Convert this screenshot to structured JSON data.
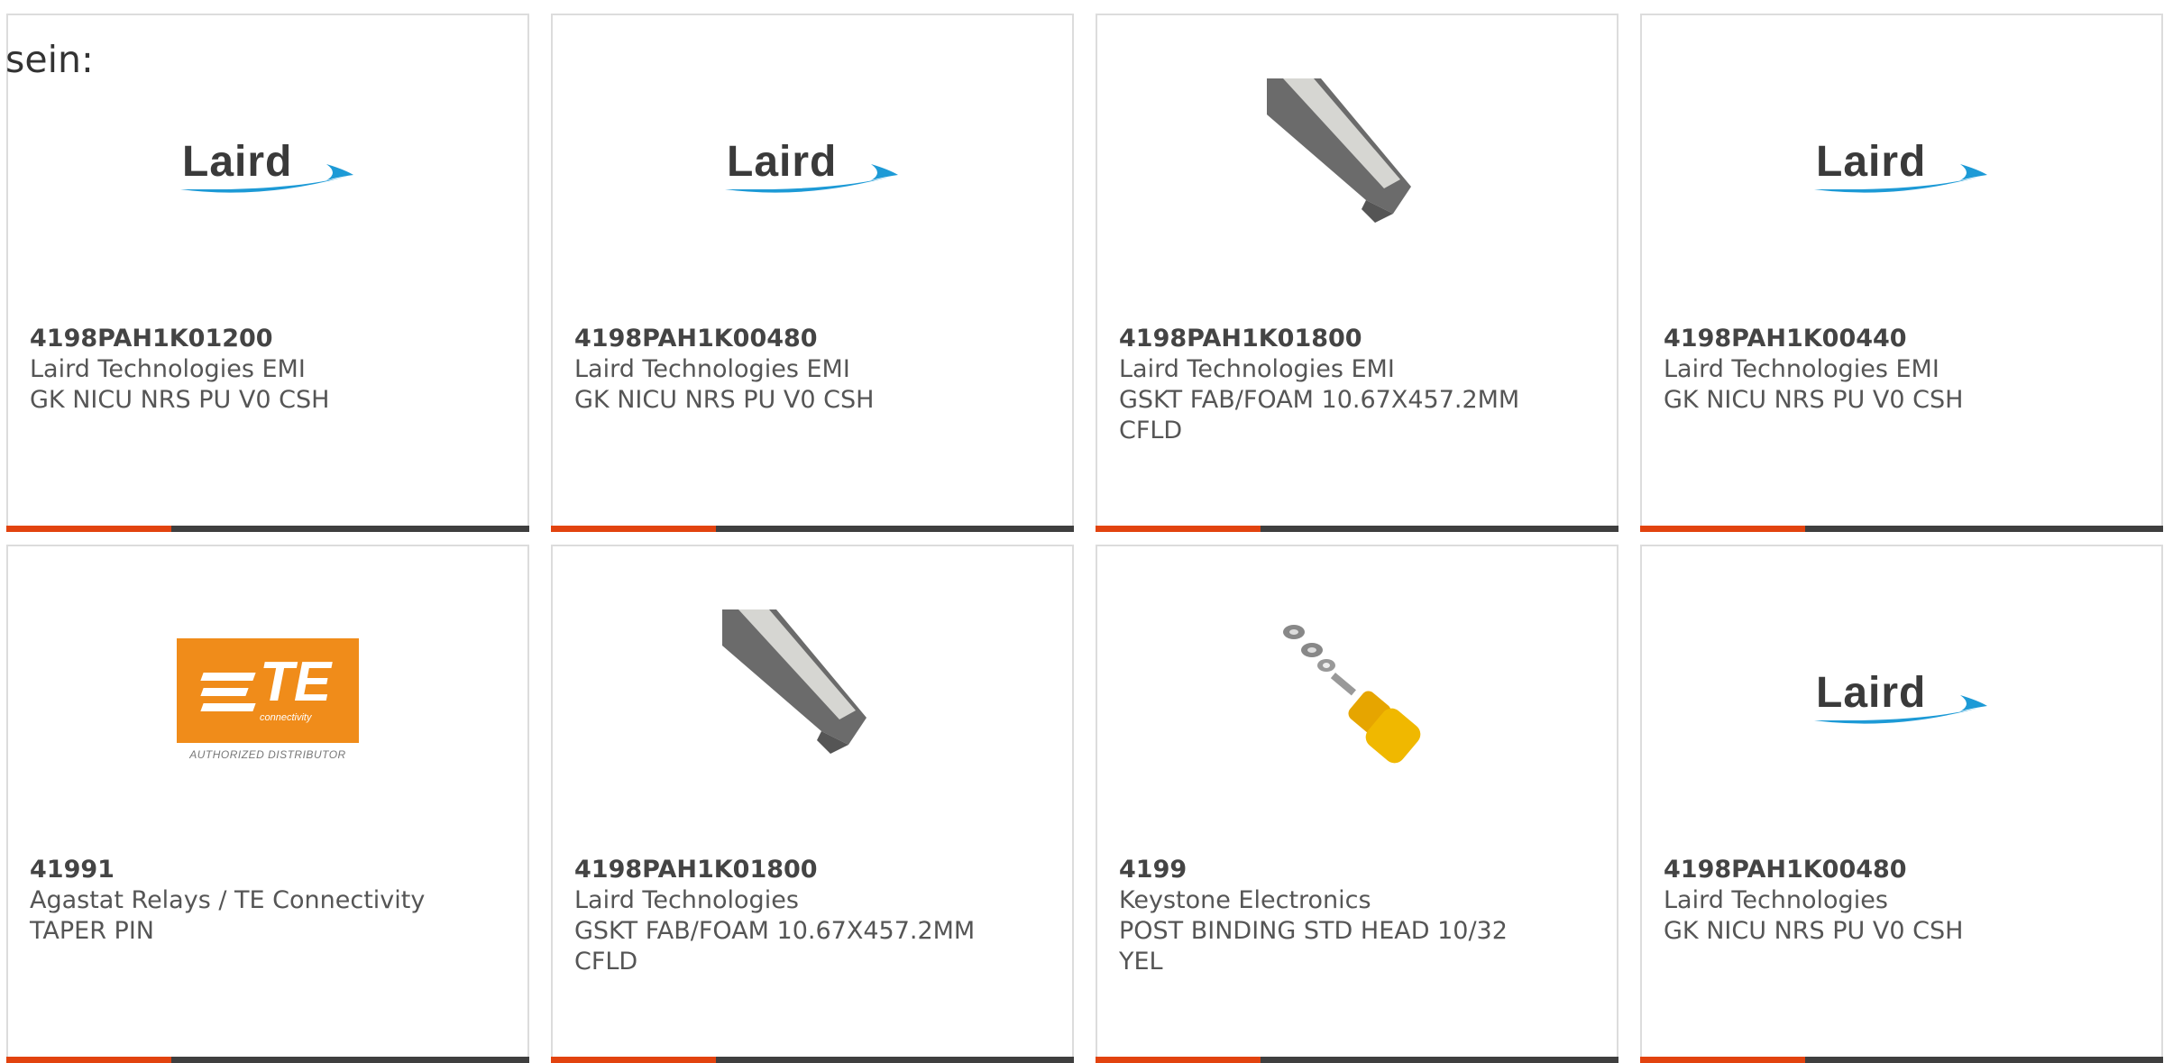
{
  "prefix_text": "sein:",
  "colors": {
    "accent": "#e2430f",
    "bar": "#3f3f3f",
    "border": "#dcdcdc"
  },
  "cards": [
    {
      "pn": "4198PAH1K01200",
      "mfr": "Laird Technologies EMI",
      "desc": "GK NICU NRS PU V0 CSH",
      "image": "laird-logo"
    },
    {
      "pn": "4198PAH1K00480",
      "mfr": "Laird Technologies EMI",
      "desc": "GK NICU NRS PU V0 CSH",
      "image": "laird-logo"
    },
    {
      "pn": "4198PAH1K01800",
      "mfr": "Laird Technologies EMI",
      "desc": "GSKT FAB/FOAM 10.67X457.2MM\nCFLD",
      "image": "gasket-photo"
    },
    {
      "pn": "4198PAH1K00440",
      "mfr": "Laird Technologies EMI",
      "desc": "GK NICU NRS PU V0 CSH",
      "image": "laird-logo"
    },
    {
      "pn": "41991",
      "mfr": "Agastat Relays / TE Connectivity",
      "desc": "TAPER PIN",
      "image": "te-logo"
    },
    {
      "pn": "4198PAH1K01800",
      "mfr": "Laird Technologies",
      "desc": "GSKT FAB/FOAM 10.67X457.2MM\nCFLD",
      "image": "gasket-photo"
    },
    {
      "pn": "4199",
      "mfr": "Keystone Electronics",
      "desc": "POST BINDING STD HEAD 10/32\nYEL",
      "image": "binding-post-photo"
    },
    {
      "pn": "4198PAH1K00480",
      "mfr": "Laird Technologies",
      "desc": "GK NICU NRS PU V0 CSH",
      "image": "laird-logo"
    }
  ],
  "logos": {
    "laird_word": "Laird",
    "te_word": "TE",
    "te_sub": "connectivity",
    "te_authorized": "AUTHORIZED DISTRIBUTOR"
  }
}
